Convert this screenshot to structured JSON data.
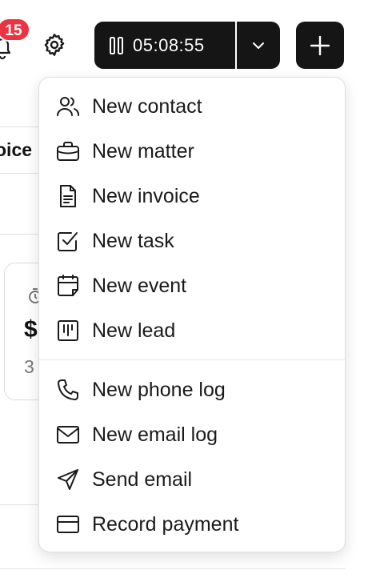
{
  "header": {
    "notification_count": "15",
    "timer_value": "05:08:55"
  },
  "background": {
    "tab_fragment": "oice",
    "card_amount": "$",
    "card_sub": "3"
  },
  "menu": {
    "group_one": [
      {
        "label": "New contact",
        "icon": "contacts-icon"
      },
      {
        "label": "New matter",
        "icon": "briefcase-icon"
      },
      {
        "label": "New invoice",
        "icon": "invoice-icon"
      },
      {
        "label": "New task",
        "icon": "task-check-icon"
      },
      {
        "label": "New event",
        "icon": "calendar-icon"
      },
      {
        "label": "New lead",
        "icon": "kanban-icon"
      }
    ],
    "group_two": [
      {
        "label": "New phone log",
        "icon": "phone-icon"
      },
      {
        "label": "New email log",
        "icon": "mail-icon"
      },
      {
        "label": "Send email",
        "icon": "send-icon"
      },
      {
        "label": "Record payment",
        "icon": "credit-card-icon"
      }
    ]
  }
}
